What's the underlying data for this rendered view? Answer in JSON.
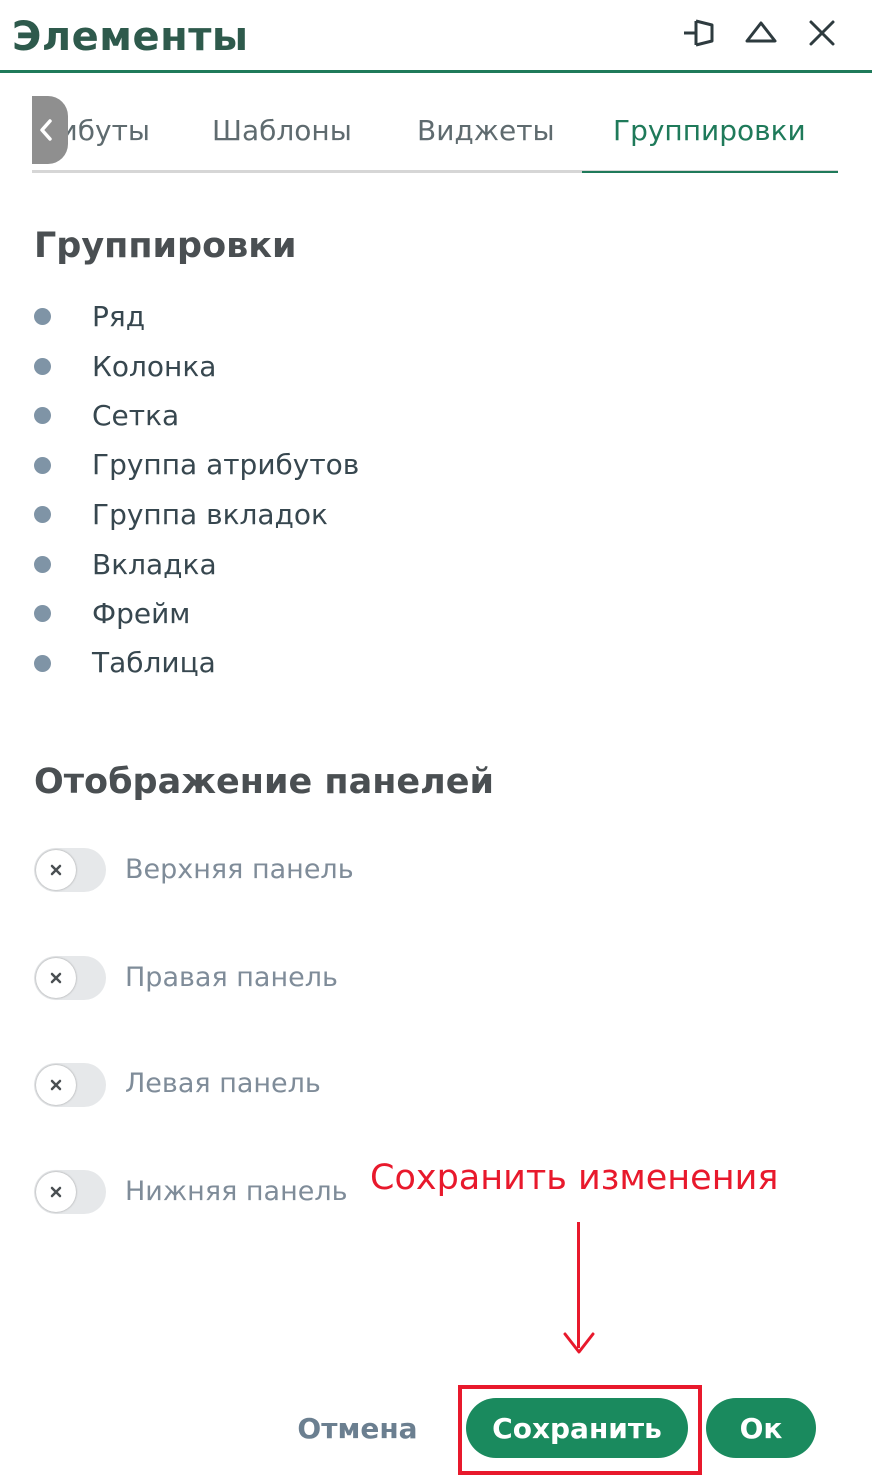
{
  "window": {
    "title": "Элементы"
  },
  "controls": {
    "pin": "pin-icon",
    "collapse": "collapse-icon",
    "close": "close-icon"
  },
  "tabs": {
    "partial_label": "Атрибуты",
    "items": [
      "Шаблоны",
      "Виджеты",
      "Группировки"
    ],
    "active": "Группировки"
  },
  "groupings": {
    "heading": "Группировки",
    "items": [
      "Ряд",
      "Колонка",
      "Сетка",
      "Группа атрибутов",
      "Группа вкладок",
      "Вкладка",
      "Фрейм",
      "Таблица"
    ]
  },
  "panels": {
    "heading": "Отображение панелей",
    "toggles": [
      {
        "label": "Верхняя панель",
        "on": false
      },
      {
        "label": "Правая панель",
        "on": false
      },
      {
        "label": "Левая панель",
        "on": false
      },
      {
        "label": "Нижняя панель",
        "on": false
      }
    ]
  },
  "annotation": {
    "text": "Сохранить изменения",
    "color": "#e8192c"
  },
  "buttons": {
    "cancel": "Отмена",
    "save": "Сохранить",
    "ok": "Ок"
  },
  "colors": {
    "accent": "#1a8a5e",
    "header_line": "#1f7a5a",
    "bullet": "#7f94a6"
  }
}
